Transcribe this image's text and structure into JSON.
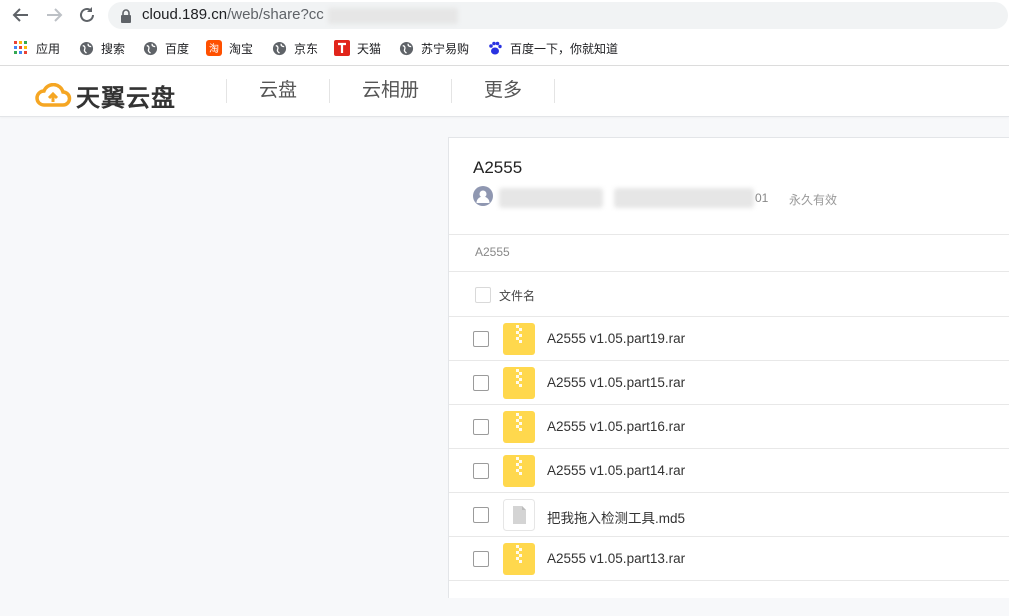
{
  "browser": {
    "url_host": "cloud.189.cn",
    "url_path": "/web/share?cc",
    "bookmarks": [
      {
        "label": "应用",
        "icon": "apps-grid-icon"
      },
      {
        "label": "搜索",
        "icon": "globe-icon"
      },
      {
        "label": "百度",
        "icon": "globe-icon"
      },
      {
        "label": "淘宝",
        "icon": "taobao-icon"
      },
      {
        "label": "京东",
        "icon": "globe-icon"
      },
      {
        "label": "天猫",
        "icon": "tmall-icon"
      },
      {
        "label": "苏宁易购",
        "icon": "globe-icon"
      },
      {
        "label": "百度一下，你就知道",
        "icon": "baidu-paw-icon"
      }
    ]
  },
  "app": {
    "logo_text": "天翼云盘",
    "nav": [
      "云盘",
      "云相册",
      "更多"
    ]
  },
  "share": {
    "title": "A2555",
    "date_suffix": "01",
    "validity": "永久有效",
    "breadcrumb": "A2555",
    "column_header": "文件名",
    "files": [
      {
        "name": "A2555 v1.05.part19.rar",
        "type": "zip"
      },
      {
        "name": "A2555 v1.05.part15.rar",
        "type": "zip"
      },
      {
        "name": "A2555 v1.05.part16.rar",
        "type": "zip"
      },
      {
        "name": "A2555 v1.05.part14.rar",
        "type": "zip"
      },
      {
        "name": "把我拖入检测工具.md5",
        "type": "doc"
      },
      {
        "name": "A2555 v1.05.part13.rar",
        "type": "zip"
      }
    ]
  },
  "colors": {
    "zip_icon": "#ffd84d",
    "accent_orange": "#f5a623"
  }
}
